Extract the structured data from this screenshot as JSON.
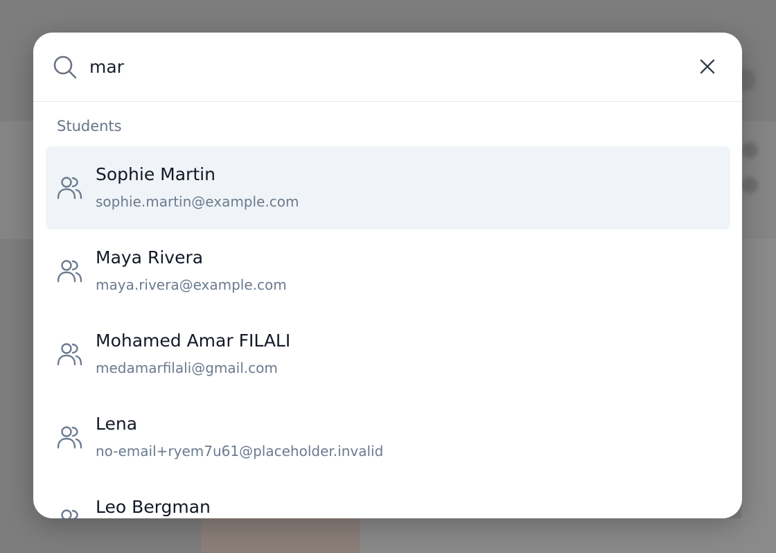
{
  "search": {
    "value": "mar",
    "icon": "search-icon",
    "clear_icon": "close-icon"
  },
  "section": {
    "label": "Students"
  },
  "results": [
    {
      "name": "Sophie Martin",
      "email": "sophie.martin@example.com",
      "icon": "users-icon",
      "highlighted": true
    },
    {
      "name": "Maya Rivera",
      "email": "maya.rivera@example.com",
      "icon": "users-icon",
      "highlighted": false
    },
    {
      "name": "Mohamed Amar FILALI",
      "email": "medamarfilali@gmail.com",
      "icon": "users-icon",
      "highlighted": false
    },
    {
      "name": "Lena",
      "email": "no-email+ryem7u61@placeholder.invalid",
      "icon": "users-icon",
      "highlighted": false
    },
    {
      "name": "Leo Bergman",
      "email": "",
      "icon": "users-icon",
      "highlighted": false
    }
  ],
  "colors": {
    "overlay": "#7b7b7b",
    "highlight": "#f0f4f8",
    "text_primary": "#121826",
    "text_secondary": "#6b7a8f",
    "icon": "#6b7a8f"
  }
}
